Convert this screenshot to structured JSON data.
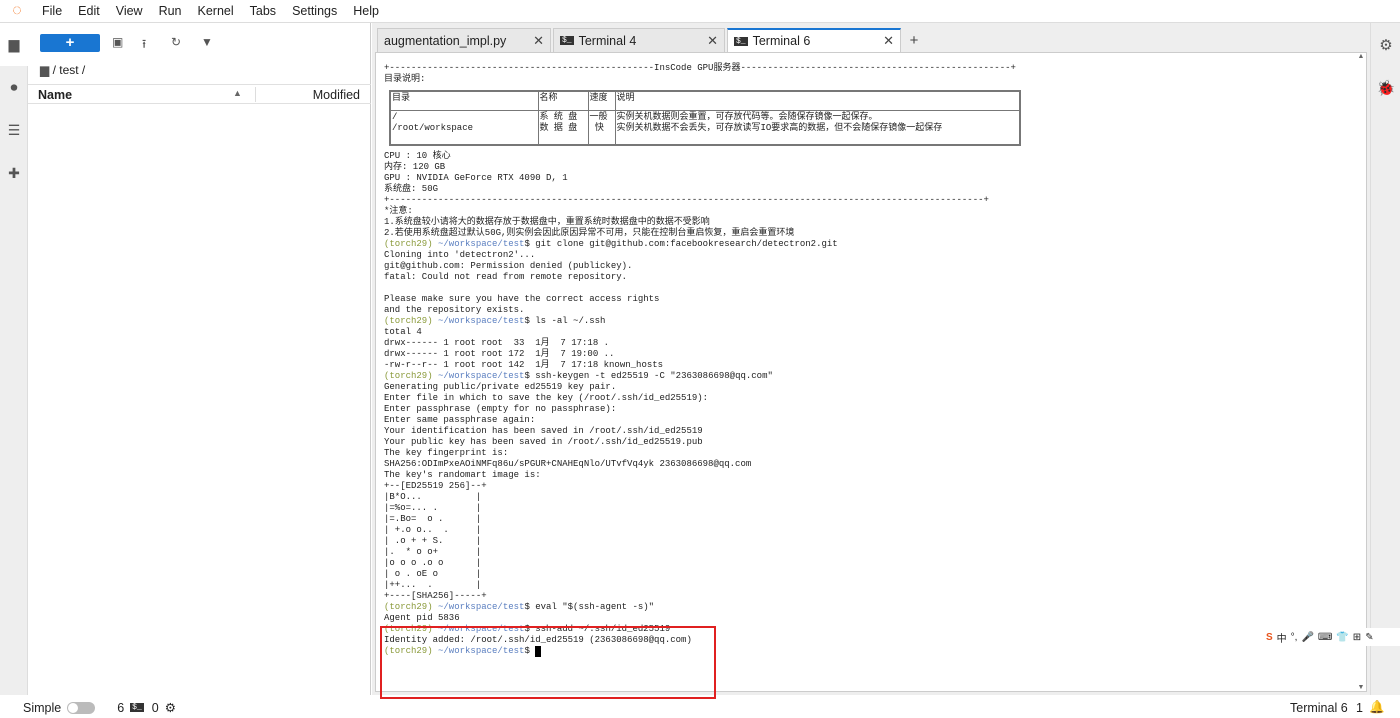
{
  "menu": [
    "File",
    "Edit",
    "View",
    "Run",
    "Kernel",
    "Tabs",
    "Settings",
    "Help"
  ],
  "filebrowser": {
    "new_label": "+",
    "breadcrumb": "/ test /",
    "col_name": "Name",
    "col_modified": "Modified"
  },
  "tabs": [
    {
      "label": "augmentation_impl.py",
      "icon": "python-file-icon",
      "active": false
    },
    {
      "label": "Terminal 4",
      "icon": "terminal-icon",
      "active": false
    },
    {
      "label": "Terminal 6",
      "icon": "terminal-icon",
      "active": true
    }
  ],
  "terminal": {
    "table": {
      "headers": [
        "目录",
        "名称",
        "速度",
        "说明"
      ],
      "rows": [
        [
          "/\n/root/workspace",
          "系 统 盘\n数 据 盘",
          "一般\n 快",
          "实例关机数据则会重置，可存放代码等。会随保存镜像一起保存。\n实例关机数据不会丢失，可存放读写IO要求高的数据，但不会随保存镜像一起保存"
        ]
      ]
    },
    "lines": [
      {
        "t": "+-------------------------------------------------InsCode GPU服务器--------------------------------------------------+"
      },
      {
        "t": "目录说明:"
      },
      {
        "t": ""
      },
      {
        "t": ""
      },
      {
        "t": ""
      },
      {
        "t": ""
      },
      {
        "t": ""
      },
      {
        "t": ""
      },
      {
        "t": "CPU : 10 核心"
      },
      {
        "t": "内存: 120 GB"
      },
      {
        "t": "GPU : NVIDIA GeForce RTX 4090 D, 1"
      },
      {
        "t": "系统盘: 50G"
      },
      {
        "t": "+--------------------------------------------------------------------------------------------------------------+"
      },
      {
        "t": "*注意:"
      },
      {
        "t": "1.系统盘较小请将大的数据存放于数据盘中，重置系统时数据盘中的数据不受影响"
      },
      {
        "t": "2.若使用系统盘超过默认50G,则实例会因此原因异常不可用，只能在控制台重启恢复，重启会重置环境"
      },
      {
        "env": "(torch29)",
        "path": " ~/workspace/test",
        "t": "$ git clone git@github.com:facebookresearch/detectron2.git"
      },
      {
        "t": "Cloning into 'detectron2'..."
      },
      {
        "t": "git@github.com: Permission denied (publickey)."
      },
      {
        "t": "fatal: Could not read from remote repository."
      },
      {
        "t": ""
      },
      {
        "t": "Please make sure you have the correct access rights"
      },
      {
        "t": "and the repository exists."
      },
      {
        "env": "(torch29)",
        "path": " ~/workspace/test",
        "t": "$ ls -al ~/.ssh"
      },
      {
        "t": "total 4"
      },
      {
        "t": "drwx------ 1 root root  33  1月  7 17:18 ."
      },
      {
        "t": "drwx------ 1 root root 172  1月  7 19:00 .."
      },
      {
        "t": "-rw-r--r-- 1 root root 142  1月  7 17:18 known_hosts"
      },
      {
        "env": "(torch29)",
        "path": " ~/workspace/test",
        "t": "$ ssh-keygen -t ed25519 -C \"2363086698@qq.com\""
      },
      {
        "t": "Generating public/private ed25519 key pair."
      },
      {
        "t": "Enter file in which to save the key (/root/.ssh/id_ed25519):"
      },
      {
        "t": "Enter passphrase (empty for no passphrase):"
      },
      {
        "t": "Enter same passphrase again:"
      },
      {
        "t": "Your identification has been saved in /root/.ssh/id_ed25519"
      },
      {
        "t": "Your public key has been saved in /root/.ssh/id_ed25519.pub"
      },
      {
        "t": "The key fingerprint is:"
      },
      {
        "t": "SHA256:ODImPxeAOiNMFq86u/sPGUR+CNAHEqNlo/UTvfVq4yk 2363086698@qq.com"
      },
      {
        "t": "The key's randomart image is:"
      },
      {
        "t": "+--[ED25519 256]--+"
      },
      {
        "t": "|B*O...          |"
      },
      {
        "t": "|=%o=... .       |"
      },
      {
        "t": "|=.Bo=  o .      |"
      },
      {
        "t": "| +.o o..  .     |"
      },
      {
        "t": "| .o + + S.      |"
      },
      {
        "t": "|.  * o o+       |"
      },
      {
        "t": "|o o o .o o      |"
      },
      {
        "t": "| o . oE o       |"
      },
      {
        "t": "|++...  .        |"
      },
      {
        "t": "+----[SHA256]-----+"
      },
      {
        "env": "(torch29)",
        "path": " ~/workspace/test",
        "t": "$ eval \"$(ssh-agent -s)\""
      },
      {
        "t": "Agent pid 5836"
      },
      {
        "env": "(torch29)",
        "path": " ~/workspace/test",
        "t": "$ ssh-add ~/.ssh/id_ed25519"
      },
      {
        "t": "Identity added: /root/.ssh/id_ed25519 (2363086698@qq.com)"
      },
      {
        "env": "(torch29)",
        "path": " ~/workspace/test",
        "t": "$ ",
        "cursor": true
      }
    ]
  },
  "ime": [
    "S",
    "中",
    "°,",
    "🎤",
    "⌨",
    "👕",
    "⊞",
    "✎"
  ],
  "status": {
    "mode": "Simple",
    "kernels": "6",
    "terminals": "0",
    "right_label": "Terminal 6",
    "notifications": "1"
  }
}
